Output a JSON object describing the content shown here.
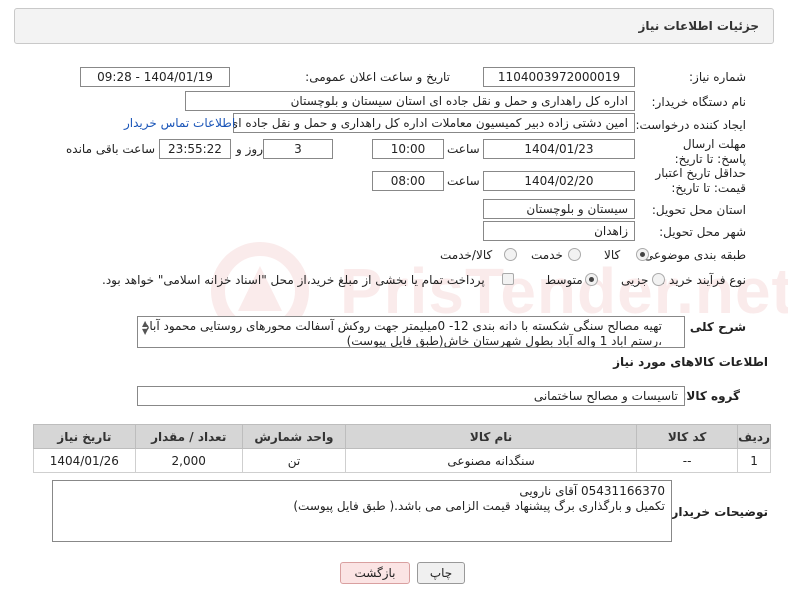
{
  "header": {
    "title": "جزئیات اطلاعات نیاز"
  },
  "fields": {
    "need_number_label": "شماره نیاز:",
    "need_number": "1104003972000019",
    "announce_label": "تاریخ و ساعت اعلان عمومی:",
    "announce_value": "1404/01/19 - 09:28",
    "buyer_org_label": "نام دستگاه خریدار:",
    "buyer_org": "اداره کل راهداری و حمل و نقل جاده ای استان سیستان و بلوچستان",
    "creator_label": "ایجاد کننده درخواست:",
    "creator": "امین دشتی زاده دبیر کمیسیون معاملات اداره کل راهداری و حمل و نقل جاده ای",
    "buyer_contact_link": "اطلاعات تماس خریدار",
    "deadline_label": "مهلت ارسال پاسخ: تا تاریخ:",
    "deadline_date": "1404/01/23",
    "time_label": "ساعت",
    "deadline_time": "10:00",
    "days": "3",
    "days_and_label": "روز و",
    "remaining_time": "23:55:22",
    "remaining_label": "ساعت باقی مانده",
    "price_validity_label": "حداقل تاریخ اعتبار قیمت: تا تاریخ:",
    "price_validity_date": "1404/02/20",
    "price_validity_time": "08:00",
    "province_label": "استان محل تحویل:",
    "province": "سیستان و بلوچستان",
    "city_label": "شهر محل تحویل:",
    "city": "زاهدان",
    "category_label": "طبقه بندی موضوعی:",
    "category_options": [
      "کالا",
      "خدمت",
      "کالا/خدمت"
    ],
    "process_label": "نوع فرآیند خرید :",
    "process_options": [
      "جزیی",
      "متوسط"
    ],
    "payment_note": "پرداخت تمام یا بخشی از مبلغ خرید،از محل \"اسناد خزانه اسلامی\" خواهد بود."
  },
  "description": {
    "label": "شرح کلی نیاز:",
    "text": "تهیه مصالح سنگی شکسته با دانه بندی 12- 0میلیمتر جهت روکش آسفالت محورهای روستایی محمود آباد ،رستم اباد 1 واله آباد بطول  شهرستان خاش(طبق فایل پیوست)"
  },
  "goods": {
    "section_title": "اطلاعات کالاهای مورد نیاز",
    "group_label": "گروه کالا:",
    "group_value": "تاسیسات و مصالح ساختمانی",
    "table": {
      "headers": [
        "ردیف",
        "کد کالا",
        "نام کالا",
        "واحد شمارش",
        "تعداد / مقدار",
        "تاریخ نیاز"
      ],
      "rows": [
        [
          "1",
          "--",
          "سنگدانه مصنوعی",
          "تن",
          "2,000",
          "1404/01/26"
        ]
      ]
    }
  },
  "buyer_notes": {
    "label": "توضیحات خریدار:",
    "line1": "05431166370 آقای نارویی",
    "line2": "تکمیل و بارگذاری برگ پیشنهاد قیمت الزامی می باشد.( طبق فایل پیوست)"
  },
  "buttons": {
    "print": "چاپ",
    "back": "بازگشت"
  },
  "watermark": {
    "text": "PrisTender.net"
  },
  "colors": {
    "link": "#1a55b8",
    "back_button_bg": "#fbe4e4",
    "header_bg": "#f3f3f3"
  }
}
